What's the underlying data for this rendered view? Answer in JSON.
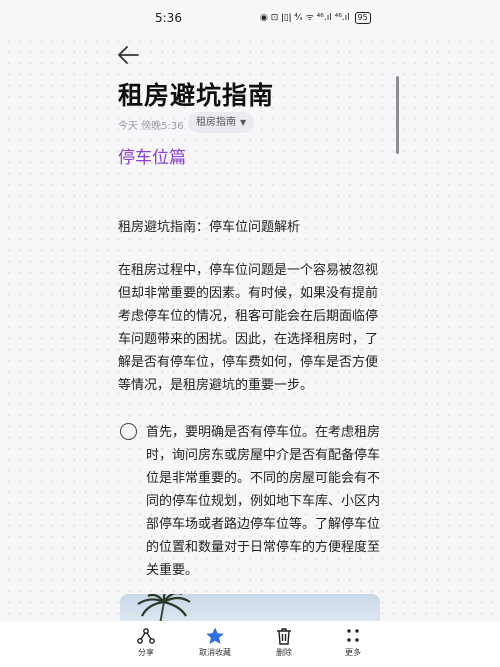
{
  "status_bar": {
    "time": "5:36",
    "icons_text": "◉ ⊡ ǀ▯ǀ ⁴⁄ₛ ᯤ ⁴⁶.ıl ⁴⁶.ıl",
    "battery": "95"
  },
  "note": {
    "title": "租房避坑指南",
    "meta": "今天 傍晚5:36",
    "folder": "租房指南",
    "subtitle": "停车位篇",
    "intro_line": "租房避坑指南：停车位问题解析",
    "paragraph": "在租房过程中，停车位问题是一个容易被忽视但却非常重要的因素。有时候，如果没有提前考虑停车位的情况，租客可能会在后期面临停车问题带来的困扰。因此，在选择租房时，了解是否有停车位，停车费如何，停车是否方便等情况，是租房避坑的重要一步。",
    "todo_item": "首先，要明确是否有停车位。在考虑租房时，询问房东或房屋中介是否有配备停车位是非常重要的。不同的房屋可能会有不同的停车位规划，例如地下车库、小区内部停车场或者路边停车位等。了解停车位的位置和数量对于日常停车的方便程度至关重要。"
  },
  "bottom_actions": {
    "share": "分享",
    "unfavorite": "取消收藏",
    "delete": "删除",
    "more": "更多"
  },
  "colors": {
    "accent": "#8a3fd6",
    "star": "#2f6fe6"
  }
}
